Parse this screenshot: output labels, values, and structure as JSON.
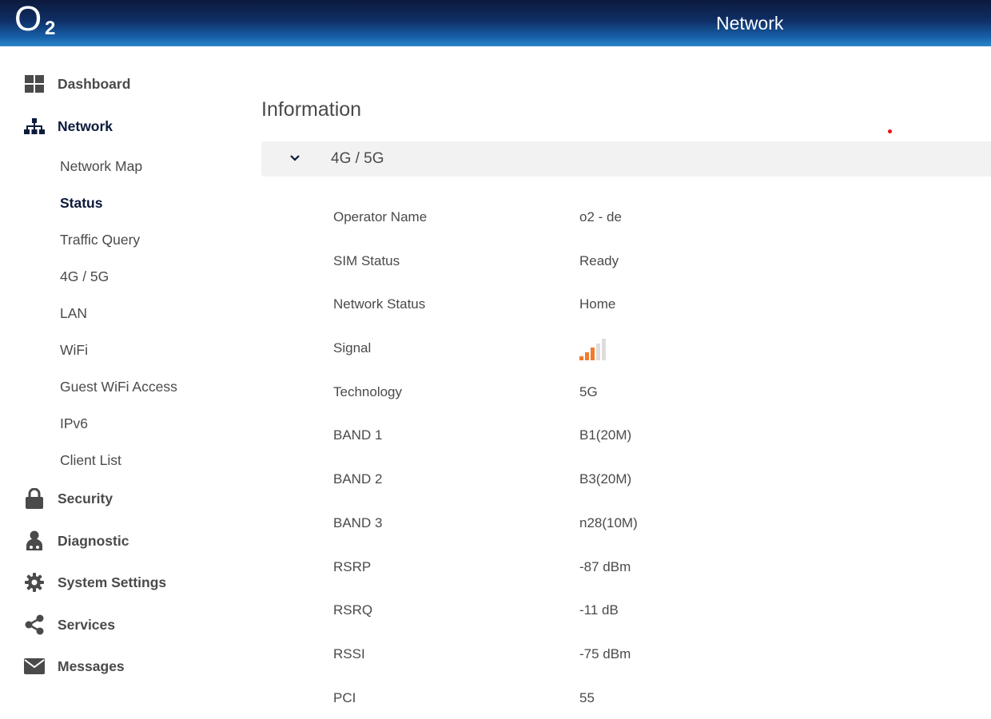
{
  "header": {
    "logo_main": "O",
    "logo_sub": "2",
    "title": "Network"
  },
  "sidebar": {
    "main_items": [
      {
        "label": "Dashboard",
        "icon": "dashboard-icon"
      },
      {
        "label": "Network",
        "icon": "network-icon"
      },
      {
        "label": "Security",
        "icon": "lock-icon"
      },
      {
        "label": "Diagnostic",
        "icon": "diagnostic-icon"
      },
      {
        "label": "System Settings",
        "icon": "gear-icon"
      },
      {
        "label": "Services",
        "icon": "share-icon"
      },
      {
        "label": "Messages",
        "icon": "envelope-icon"
      }
    ],
    "network_sub_items": [
      {
        "label": "Network Map"
      },
      {
        "label": "Status"
      },
      {
        "label": "Traffic Query"
      },
      {
        "label": "4G / 5G"
      },
      {
        "label": "LAN"
      },
      {
        "label": "WiFi"
      },
      {
        "label": "Guest WiFi Access"
      },
      {
        "label": "IPv6"
      },
      {
        "label": "Client List"
      }
    ],
    "active_sub": "Status"
  },
  "main": {
    "heading": "Information",
    "section_title": "4G / 5G",
    "rows": [
      {
        "label": "Operator Name",
        "value": "o2 - de"
      },
      {
        "label": "SIM Status",
        "value": "Ready"
      },
      {
        "label": "Network Status",
        "value": "Home"
      },
      {
        "label": "Signal",
        "value": ""
      },
      {
        "label": "Technology",
        "value": "5G"
      },
      {
        "label": "BAND 1",
        "value": "B1(20M)"
      },
      {
        "label": "BAND 2",
        "value": "B3(20M)"
      },
      {
        "label": "BAND 3",
        "value": "n28(10M)"
      },
      {
        "label": "RSRP",
        "value": "-87 dBm"
      },
      {
        "label": "RSRQ",
        "value": "-11 dB"
      },
      {
        "label": "RSSI",
        "value": "-75 dBm"
      },
      {
        "label": "PCI",
        "value": "55"
      }
    ],
    "signal": {
      "level": 3,
      "max": 5,
      "active_color": "#f07c2e",
      "inactive_color": "#dddddd"
    }
  },
  "colors": {
    "brand_dark": "#0c1a3c",
    "brand_light": "#2a86cc",
    "text": "#4a4a4a"
  }
}
